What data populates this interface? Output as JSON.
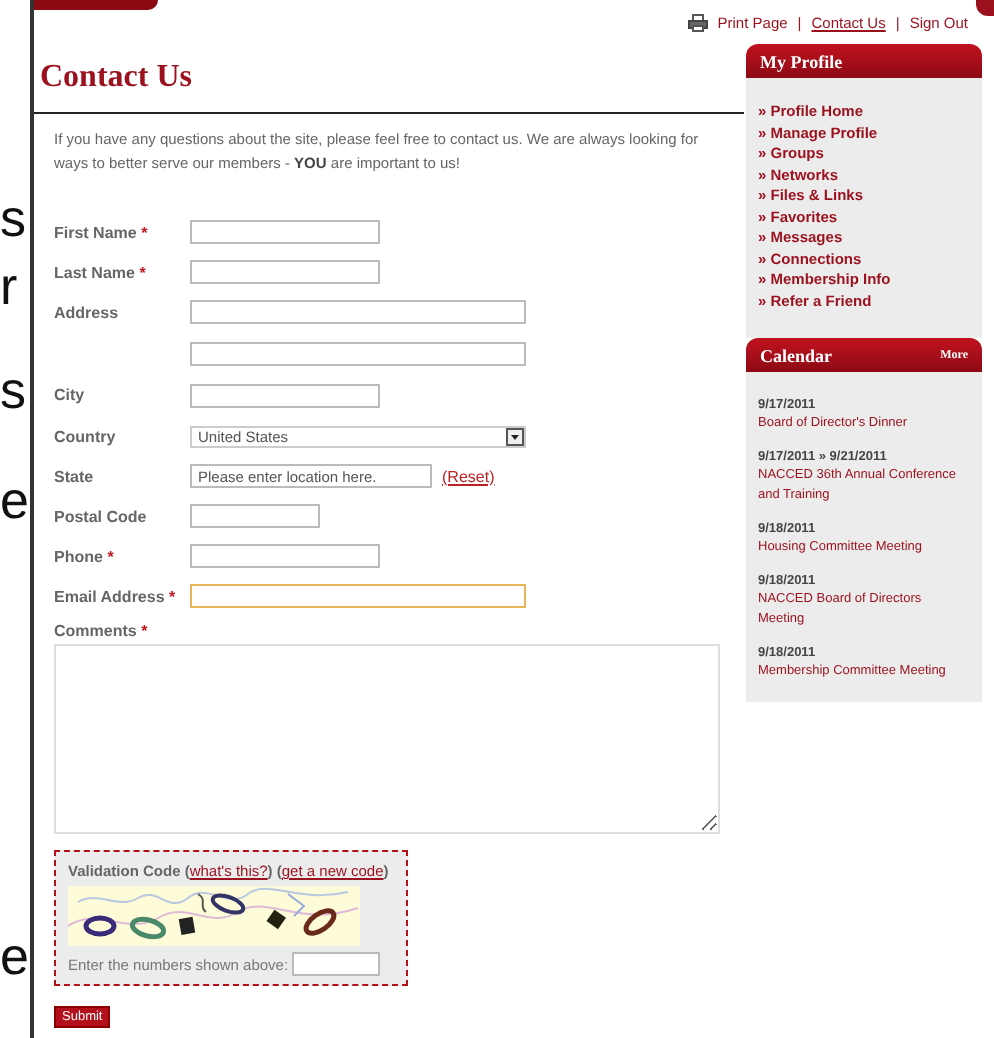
{
  "background_letters": [
    "s",
    "r",
    "s",
    "e",
    "e"
  ],
  "top_links": [
    {
      "kind": "link",
      "text": "Print Page"
    },
    {
      "kind": "separator",
      "text": "|"
    },
    {
      "kind": "link",
      "text": "Contact Us"
    },
    {
      "kind": "separator",
      "text": "|"
    },
    {
      "kind": "link",
      "text": "Sign Out"
    }
  ],
  "page_title": "Contact Us",
  "intro": "If you have any questions about the site, please feel free to contact us. We are always looking for ways to better serve our members - **YOU** are important to us!",
  "form": {
    "fields": [
      {
        "kind": "text",
        "label": "First Name",
        "required_mark": "*"
      },
      {
        "kind": "text",
        "label": "Last Name",
        "required_mark": "*"
      },
      {
        "kind": "text",
        "label": "Address"
      },
      {
        "kind": "text"
      },
      {
        "kind": "text",
        "label": "City"
      },
      {
        "kind": "select",
        "label": "Country",
        "value": "United States"
      },
      {
        "kind": "text",
        "label": "State",
        "value": "Please enter location here.",
        "link": "(Reset)"
      },
      {
        "kind": "text",
        "label": "Postal Code"
      },
      {
        "kind": "text",
        "label": "Phone",
        "required_mark": "*"
      },
      {
        "kind": "text",
        "label": "Email Address",
        "required_mark": "*",
        "focused": true
      },
      {
        "kind": "textarea",
        "label": "Comments",
        "required_mark": "*"
      }
    ],
    "captcha": {
      "text_parts": [
        "Validation Code (",
        ") (",
        ")"
      ],
      "links": [
        "what's this?",
        "get a new code"
      ],
      "prompt": "Enter the numbers shown above:"
    },
    "submit": "Submit"
  },
  "sidebar": {
    "profile": {
      "title": "My Profile",
      "items": [
        "» Profile Home",
        "» Manage Profile",
        "» Groups",
        "» Networks",
        "» Files & Links",
        "» Favorites",
        "» Messages",
        "» Connections",
        "» Membership Info",
        "» Refer a Friend"
      ]
    },
    "calendar": {
      "title": "Calendar",
      "more": "More",
      "events": [
        {
          "date": "9/17/2011",
          "title": "Board of Director's Dinner"
        },
        {
          "date": "9/17/2011 » 9/21/2011",
          "title": "NACCED 36th Annual Conference and Training"
        },
        {
          "date": "9/18/2011",
          "title": "Housing Committee Meeting"
        },
        {
          "date": "9/18/2011",
          "title": "NACCED Board of Directors Meeting"
        },
        {
          "date": "9/18/2011",
          "title": "Membership Committee Meeting"
        }
      ]
    }
  }
}
